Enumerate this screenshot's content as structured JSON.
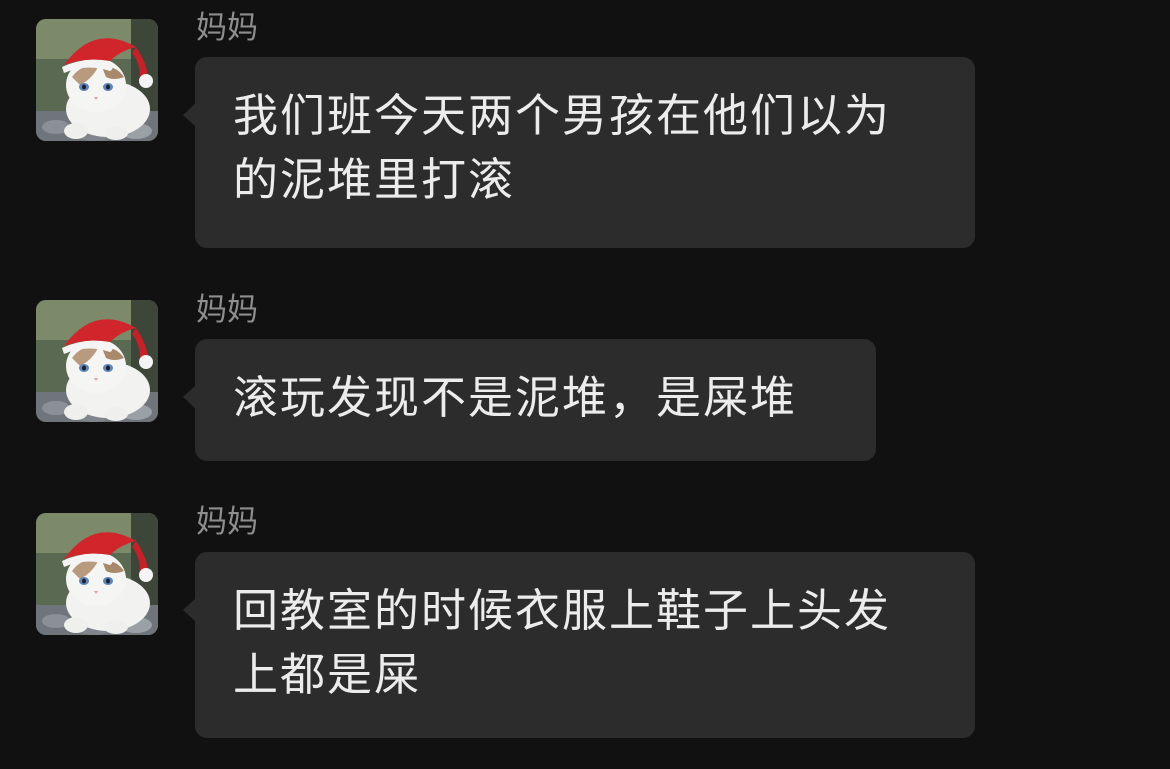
{
  "messages": [
    {
      "sender": "妈妈",
      "text": "我们班今天两个男孩在他们以为的泥堆里打滚"
    },
    {
      "sender": "妈妈",
      "text": "滚玩发现不是泥堆，是屎堆"
    },
    {
      "sender": "妈妈",
      "text": "回教室的时候衣服上鞋子上头发上都是屎"
    }
  ],
  "colors": {
    "background": "#111111",
    "bubble": "#2c2c2c",
    "sender_text": "#8e8e8e",
    "message_text": "#ececec"
  },
  "icons": [
    "avatar-cat-santa-hat"
  ]
}
